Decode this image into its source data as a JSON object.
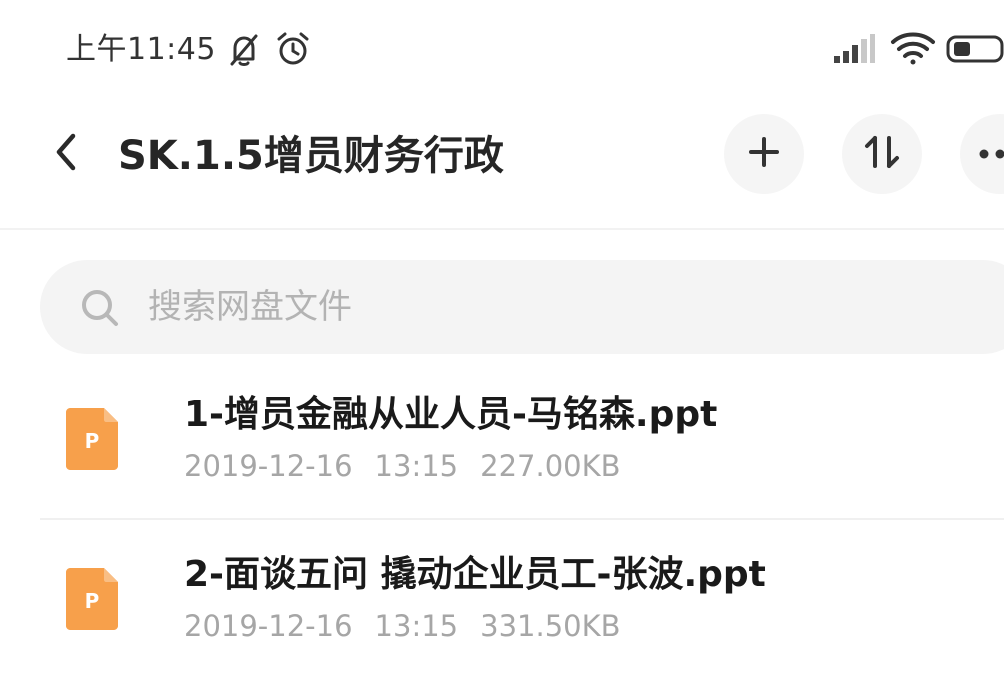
{
  "status_bar": {
    "time": "上午11:45"
  },
  "header": {
    "title": "SK.1.5增员财务行政"
  },
  "search": {
    "placeholder": "搜索网盘文件"
  },
  "files": [
    {
      "name": "1-增员金融从业人员-马铭森.ppt",
      "date": "2019-12-16",
      "time": "13:15",
      "size": "227.00KB",
      "type_letter": "P"
    },
    {
      "name": "2-面谈五问 撬动企业员工-张波.ppt",
      "date": "2019-12-16",
      "time": "13:15",
      "size": "331.50KB",
      "type_letter": "P"
    }
  ],
  "colors": {
    "ppt_icon": "#f7a04b",
    "title": "#262626",
    "meta": "#a6a6a6",
    "search_bg": "#f4f4f4"
  },
  "icons": {
    "back": "chevron-left-icon",
    "add": "plus-icon",
    "sort": "sort-icon",
    "more": "more-dots-icon",
    "search": "search-icon",
    "file": "ppt-file-icon"
  }
}
